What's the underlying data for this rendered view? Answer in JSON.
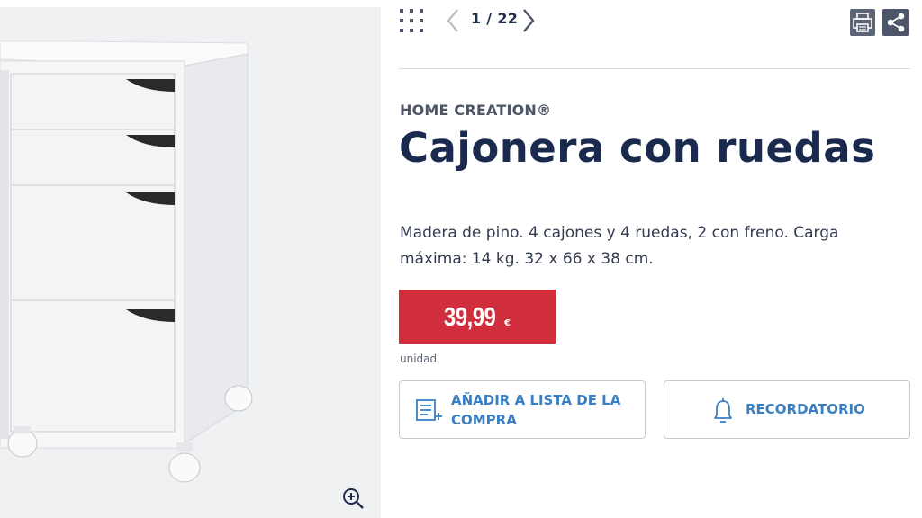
{
  "gallery": {
    "counter": "1 / 22",
    "zoom_icon": "zoom-in-icon"
  },
  "toolbar": {
    "grid_icon": "grid-icon",
    "print_icon": "print-icon",
    "share_icon": "share-icon"
  },
  "product": {
    "brand": "HOME CREATION®",
    "title": "Cajonera con ruedas",
    "description": "Madera de pino. 4 cajones y 4 ruedas, 2 con freno. Carga máxima: 14 kg. 32 x 66 x 38 cm.",
    "price": "39,99",
    "currency": "€",
    "unit": "unidad"
  },
  "actions": {
    "add_to_list": "AÑADIR A LISTA DE LA COMPRA",
    "reminder": "RECORDATORIO"
  },
  "colors": {
    "price_red": "#d02e3c",
    "navy": "#1a2a4f",
    "link_blue": "#3a7fc4"
  }
}
